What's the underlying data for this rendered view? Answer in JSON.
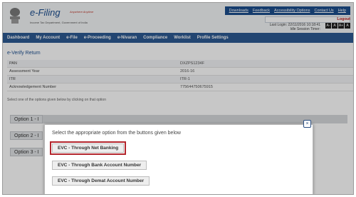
{
  "header": {
    "logo_title": "e-Filing",
    "logo_tag": "Anywhere Anytime",
    "logo_sub": "Income Tax Department, Government of India",
    "top_links": [
      "Downloads",
      "Feedback",
      "Accessibility Options",
      "Contact Us",
      "Help"
    ],
    "logout": "Logout",
    "last_login": "Last Login: 22/11/2016 10:18:41",
    "session_time": "Idle Session Timer:",
    "font_buttons": [
      "A-",
      "A",
      "A+",
      "A"
    ]
  },
  "nav": [
    "Dashboard",
    "My Account",
    "e-File",
    "e-Proceeding",
    "e-Nivaran",
    "Compliance",
    "Worklist",
    "Profile Settings"
  ],
  "page": {
    "title": "e-Verify Return",
    "rows": [
      {
        "label": "PAN",
        "value": "DXZPS1234F"
      },
      {
        "label": "Assessment Year",
        "value": "2016-16"
      },
      {
        "label": "ITR",
        "value": "ITR-1"
      },
      {
        "label": "Acknowledgement Number",
        "value": "775644750675915"
      }
    ],
    "instruction": "Select one of the options given below by clicking on that option",
    "options": [
      "Option 1 - I",
      "Option 2 - I",
      "Option 3 - I"
    ]
  },
  "modal": {
    "text": "Select the appropriate option from the buttons given below",
    "close": "×",
    "buttons": [
      "EVC - Through Net Banking",
      "EVC - Through Bank Account Number",
      "EVC - Through Demat Account Number"
    ]
  }
}
